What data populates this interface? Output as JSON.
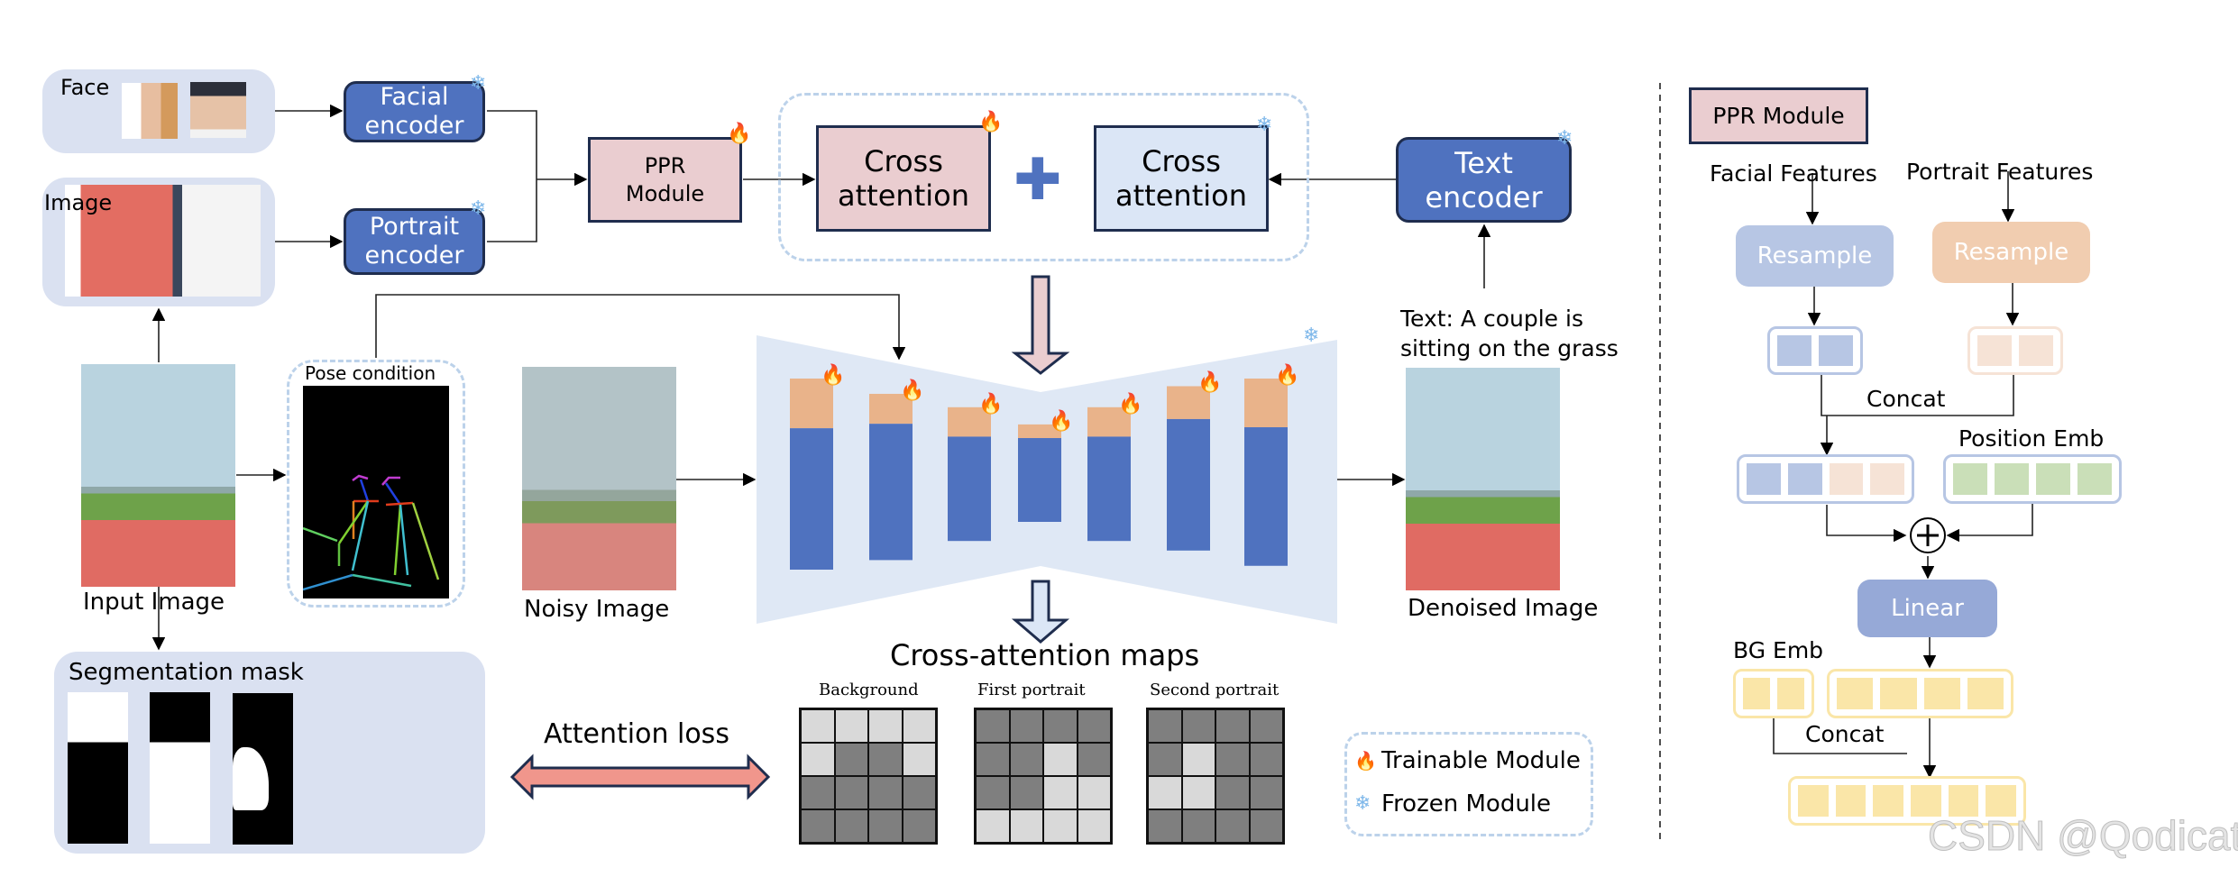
{
  "inputs": {
    "face_label": "Face",
    "image_label": "Image",
    "input_image_label": "Input Image",
    "pose_condition_label": "Pose condition",
    "noisy_image_label": "Noisy Image",
    "denoised_image_label": "Denoised Image",
    "segmentation_mask_label": "Segmentation mask"
  },
  "encoders": {
    "facial": [
      "Facial",
      "encoder"
    ],
    "portrait": [
      "Portrait",
      "encoder"
    ],
    "text": [
      "Text",
      "encoder"
    ]
  },
  "ppr_module_label": [
    "PPR",
    "Module"
  ],
  "cross_attention_trainable": [
    "Cross",
    "attention"
  ],
  "cross_attention_frozen": [
    "Cross",
    "attention"
  ],
  "plus_symbol": "✚",
  "text_prompt": [
    "Text:  A couple is",
    "sitting on the grass"
  ],
  "unet": {
    "blocks": [
      {
        "trainable_frac": 0.26,
        "span": [
          0.0,
          1.0
        ]
      },
      {
        "trainable_frac": 0.18,
        "span": [
          0.08,
          0.95
        ]
      },
      {
        "trainable_frac": 0.22,
        "span": [
          0.15,
          0.85
        ]
      },
      {
        "trainable_frac": 0.14,
        "span": [
          0.24,
          0.75
        ]
      },
      {
        "trainable_frac": 0.22,
        "span": [
          0.15,
          0.85
        ]
      },
      {
        "trainable_frac": 0.2,
        "span": [
          0.04,
          0.9
        ]
      },
      {
        "trainable_frac": 0.26,
        "span": [
          0.0,
          0.98
        ]
      }
    ],
    "colors": {
      "trainable": "#e9b38a",
      "frozen": "#4f72bf",
      "bg": "#dfe8f5"
    }
  },
  "attention_loss_label": "Attention loss",
  "cross_attention_maps": {
    "title": "Cross-attention maps",
    "maps": [
      {
        "label": "Background",
        "cells": [
          "LLLL",
          "LDDL",
          "DDDD",
          "DDDD"
        ]
      },
      {
        "label": "First portrait",
        "cells": [
          "DDDD",
          "DDLD",
          "DDLL",
          "LLLL"
        ]
      },
      {
        "label": "Second portrait",
        "cells": [
          "DDDD",
          "DLDD",
          "LLDD",
          "DDDD"
        ]
      }
    ]
  },
  "legend": {
    "trainable": "Trainable Module",
    "frozen": "Frozen Module",
    "fire_icon": "🔥",
    "snow_icon": "❄"
  },
  "ppr_detail": {
    "title": "PPR Module",
    "facial_features": "Facial Features",
    "portrait_features": "Portrait Features",
    "resample": "Resample",
    "concat": "Concat",
    "position_emb": "Position Emb",
    "linear": "Linear",
    "bg_emb": "BG Emb",
    "concat2": "Concat",
    "plus_circle": "⊕"
  },
  "watermark": "CSDN @Qodicat"
}
